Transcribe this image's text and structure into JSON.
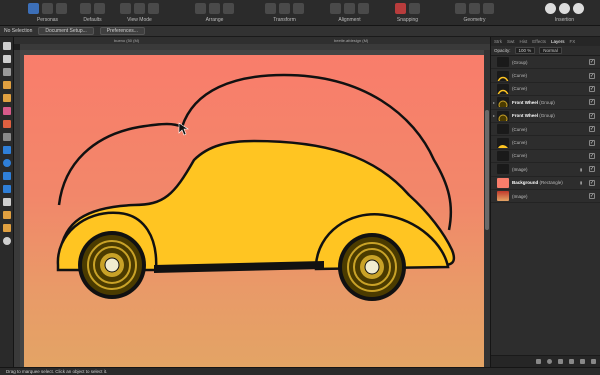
{
  "toolbar": {
    "groups": [
      {
        "label": "Personas"
      },
      {
        "label": "Defaults"
      },
      {
        "label": "View Mode"
      },
      {
        "label": "Arrange"
      },
      {
        "label": "Transform"
      },
      {
        "label": "Alignment"
      },
      {
        "label": "Snapping"
      },
      {
        "label": "Geometry"
      },
      {
        "label": "Insertion"
      }
    ]
  },
  "context": {
    "selection": "No Selection",
    "document_setup": "Document Setup...",
    "preferences": "Preferences..."
  },
  "document": {
    "zoom": "bueno (50 (M)",
    "title": "beetle.afdesign (M)"
  },
  "panel": {
    "tabs": [
      "Strk",
      "Swt",
      "Hist",
      "Effects",
      "Layers",
      "FX"
    ],
    "active_tab": "Layers",
    "opacity_label": "Opacity:",
    "opacity_value": "100 %",
    "blend_value": "Normal",
    "layers": [
      {
        "name": "(Group)",
        "bold": "",
        "checked": true
      },
      {
        "name": "(Curve)",
        "bold": "",
        "checked": true
      },
      {
        "name": "(Curve)",
        "bold": "",
        "checked": true
      },
      {
        "name": "(Group)",
        "bold": "Front Wheel",
        "checked": true
      },
      {
        "name": "(Group)",
        "bold": "Front Wheel",
        "checked": true
      },
      {
        "name": "(Curve)",
        "bold": "",
        "checked": true
      },
      {
        "name": "(Curve)",
        "bold": "",
        "checked": true
      },
      {
        "name": "(Curve)",
        "bold": "",
        "checked": true
      },
      {
        "name": "(Image)",
        "bold": "",
        "checked": true
      },
      {
        "name": "(Rectangle)",
        "bold": "Background",
        "checked": true
      },
      {
        "name": "(Image)",
        "bold": "",
        "checked": true
      }
    ]
  },
  "status": {
    "text": "Drag to marquee select. Click an object to select it."
  },
  "colors": {
    "car_body": "#ffc522",
    "outline": "#111111",
    "wheel": "#4b3b00"
  }
}
